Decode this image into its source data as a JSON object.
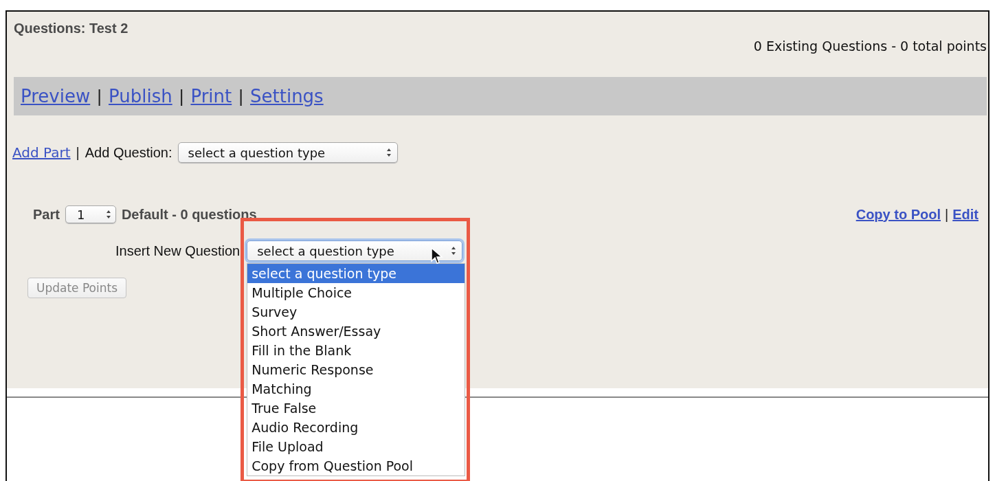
{
  "header": {
    "title": "Questions: Test 2",
    "summary": "0 Existing Questions - 0 total points"
  },
  "nav": {
    "links": [
      "Preview",
      "Publish",
      "Print",
      "Settings"
    ],
    "separators": [
      "|",
      "|",
      "|"
    ]
  },
  "add_row": {
    "link": "Add Part",
    "separator": "|",
    "label": "Add Question:",
    "select_value": "select a question type"
  },
  "part": {
    "label": "Part",
    "number": "1",
    "description": "Default - 0 questions",
    "links": [
      "Copy to Pool",
      "Edit"
    ],
    "link_separator": "|",
    "insert_label": "Insert New Question",
    "insert_select": {
      "value": "select a question type",
      "expanded": true,
      "options": [
        {
          "label": "select a question type",
          "selected": true
        },
        {
          "label": "Multiple Choice",
          "selected": false
        },
        {
          "label": "Survey",
          "selected": false
        },
        {
          "label": "Short Answer/Essay",
          "selected": false
        },
        {
          "label": "Fill in the Blank",
          "selected": false
        },
        {
          "label": "Numeric Response",
          "selected": false
        },
        {
          "label": "Matching",
          "selected": false
        },
        {
          "label": "True False",
          "selected": false
        },
        {
          "label": "Audio Recording",
          "selected": false
        },
        {
          "label": "File Upload",
          "selected": false
        },
        {
          "label": "Copy from Question Pool",
          "selected": false
        }
      ]
    },
    "update_button": {
      "label": "Update Points",
      "disabled": true
    }
  }
}
